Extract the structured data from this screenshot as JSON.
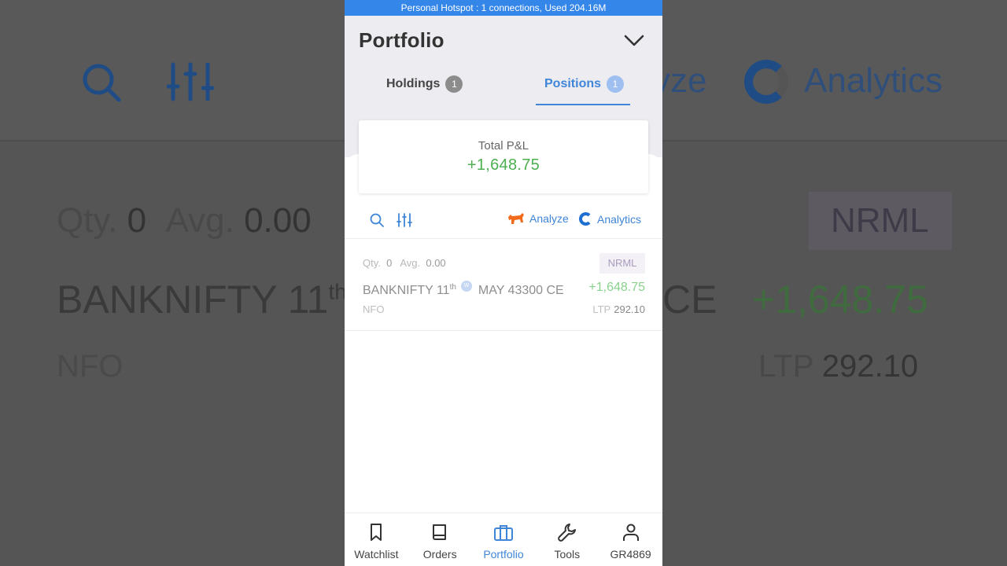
{
  "status_bar": {
    "text": "Personal Hotspot : 1 connections, Used 204.16M"
  },
  "header": {
    "title": "Portfolio"
  },
  "tabs": [
    {
      "label": "Holdings",
      "count": "1",
      "active": false
    },
    {
      "label": "Positions",
      "count": "1",
      "active": true
    }
  ],
  "summary": {
    "label": "Total P&L",
    "value": "+1,648.75"
  },
  "toolbar": {
    "analyze_label": "Analyze",
    "analytics_label": "Analytics"
  },
  "positions": [
    {
      "qty_label": "Qty.",
      "qty": "0",
      "avg_label": "Avg.",
      "avg": "0.00",
      "product": "NRML",
      "symbol_prefix": "BANKNIFTY 11",
      "symbol_sup": "th",
      "weekly_badge": "W",
      "symbol_suffix": "MAY 43300 CE",
      "pnl": "+1,648.75",
      "exchange": "NFO",
      "ltp_label": "LTP",
      "ltp": "292.10"
    }
  ],
  "bottom_nav": [
    {
      "label": "Watchlist",
      "icon": "bookmark-icon",
      "active": false
    },
    {
      "label": "Orders",
      "icon": "book-icon",
      "active": false
    },
    {
      "label": "Portfolio",
      "icon": "briefcase-icon",
      "active": true
    },
    {
      "label": "Tools",
      "icon": "wrench-icon",
      "active": false
    },
    {
      "label": "GR4869",
      "icon": "user-icon",
      "active": false
    }
  ],
  "background": {
    "analyze": "yze",
    "analytics": "Analytics",
    "qty_label": "Qty.",
    "qty": "0",
    "avg_label": "Avg.",
    "avg": "0.00",
    "product": "NRML",
    "symbol": "BANKNIFTY 11",
    "symbol_sup": "th",
    "symbol_tail": "CE",
    "pnl": "+1,648.75",
    "exchange": "NFO",
    "ltp_label": "LTP",
    "ltp": "292.10"
  },
  "colors": {
    "accent": "#3f85d8",
    "profit": "#4caf50",
    "status_bar": "#3486e8",
    "analyze_bull": "#f26b1d"
  }
}
